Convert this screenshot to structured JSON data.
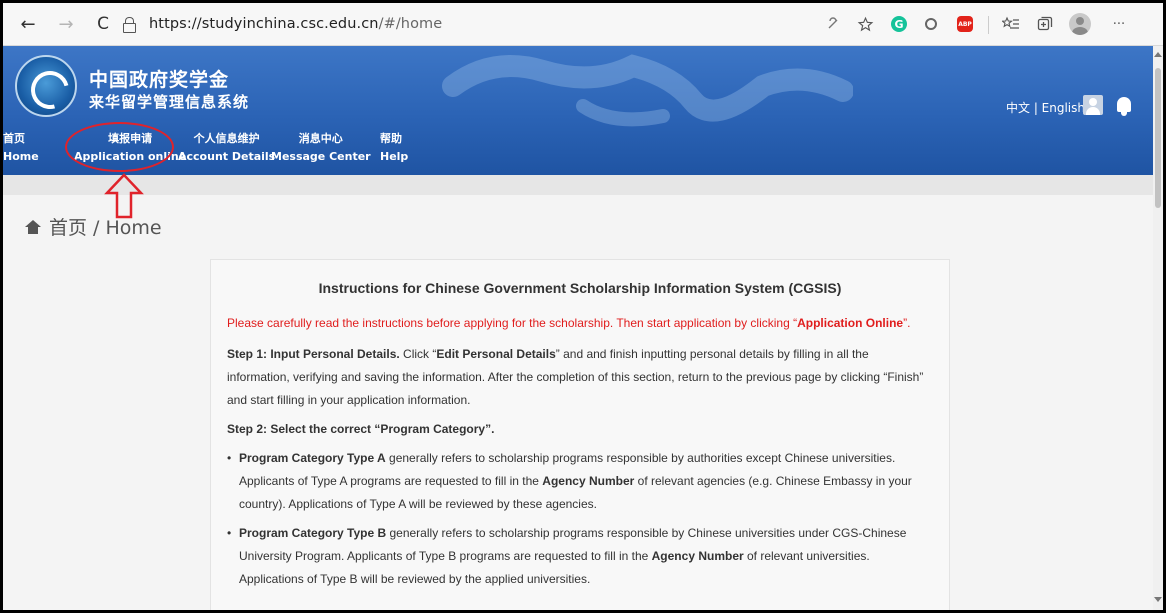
{
  "browser": {
    "url_host": "https://studyinchina.csc.edu.cn",
    "url_path": "/#/home",
    "back_glyph": "←",
    "forward_glyph": "→",
    "reload_glyph": "C",
    "more_glyph": "···",
    "grammarly_glyph": "G",
    "abp_glyph": "ABP"
  },
  "site": {
    "title_cn_line1": "中国政府奖学金",
    "title_cn_line2": "来华留学管理信息系统",
    "lang_switch": "中文 | English",
    "menu": [
      {
        "cn": "首页",
        "en": "Home"
      },
      {
        "cn": "填报申请",
        "en": "Application online"
      },
      {
        "cn": "个人信息维护",
        "en": "Account Details"
      },
      {
        "cn": "消息中心",
        "en": "Message Center"
      },
      {
        "cn": "帮助",
        "en": "Help"
      }
    ],
    "annotation_color": "#e0232b"
  },
  "breadcrumb": {
    "text": "首页 / Home"
  },
  "instructions": {
    "title": "Instructions for Chinese Government Scholarship Information System (CGSIS)",
    "intro_prefix": "Please carefully read the instructions before applying for the scholarship. Then start application by clicking “",
    "intro_bold": "Application Online",
    "intro_suffix": "”.",
    "step1_bold": "Step 1: Input Personal Details.",
    "step1_mid1": " Click “",
    "step1_bold2": "Edit Personal Details",
    "step1_rest": "” and and finish inputting personal details by filling in all the information, verifying and saving the information. After the completion of this section, return to the previous page by clicking “Finish” and start filling in your application information.",
    "step2": "Step 2: Select the correct “Program Category”.",
    "typeA_bold": "Program Category Type A",
    "typeA_rest1": " generally refers to scholarship programs responsible by authorities except Chinese universities. Applicants of Type A programs are requested to fill in the ",
    "typeA_bold2": "Agency Number",
    "typeA_rest2": " of relevant agencies (e.g. Chinese Embassy in your country). Applications of Type A will be reviewed by these agencies.",
    "typeB_bold": "Program Category Type B",
    "typeB_rest1": " generally refers to scholarship programs responsible by Chinese universities under CGS-Chinese University Program. Applicants of Type B programs are requested to fill in the ",
    "typeB_bold2": "Agency Number",
    "typeB_rest2": " of relevant universities. Applications of Type B will be reviewed by the applied universities."
  }
}
